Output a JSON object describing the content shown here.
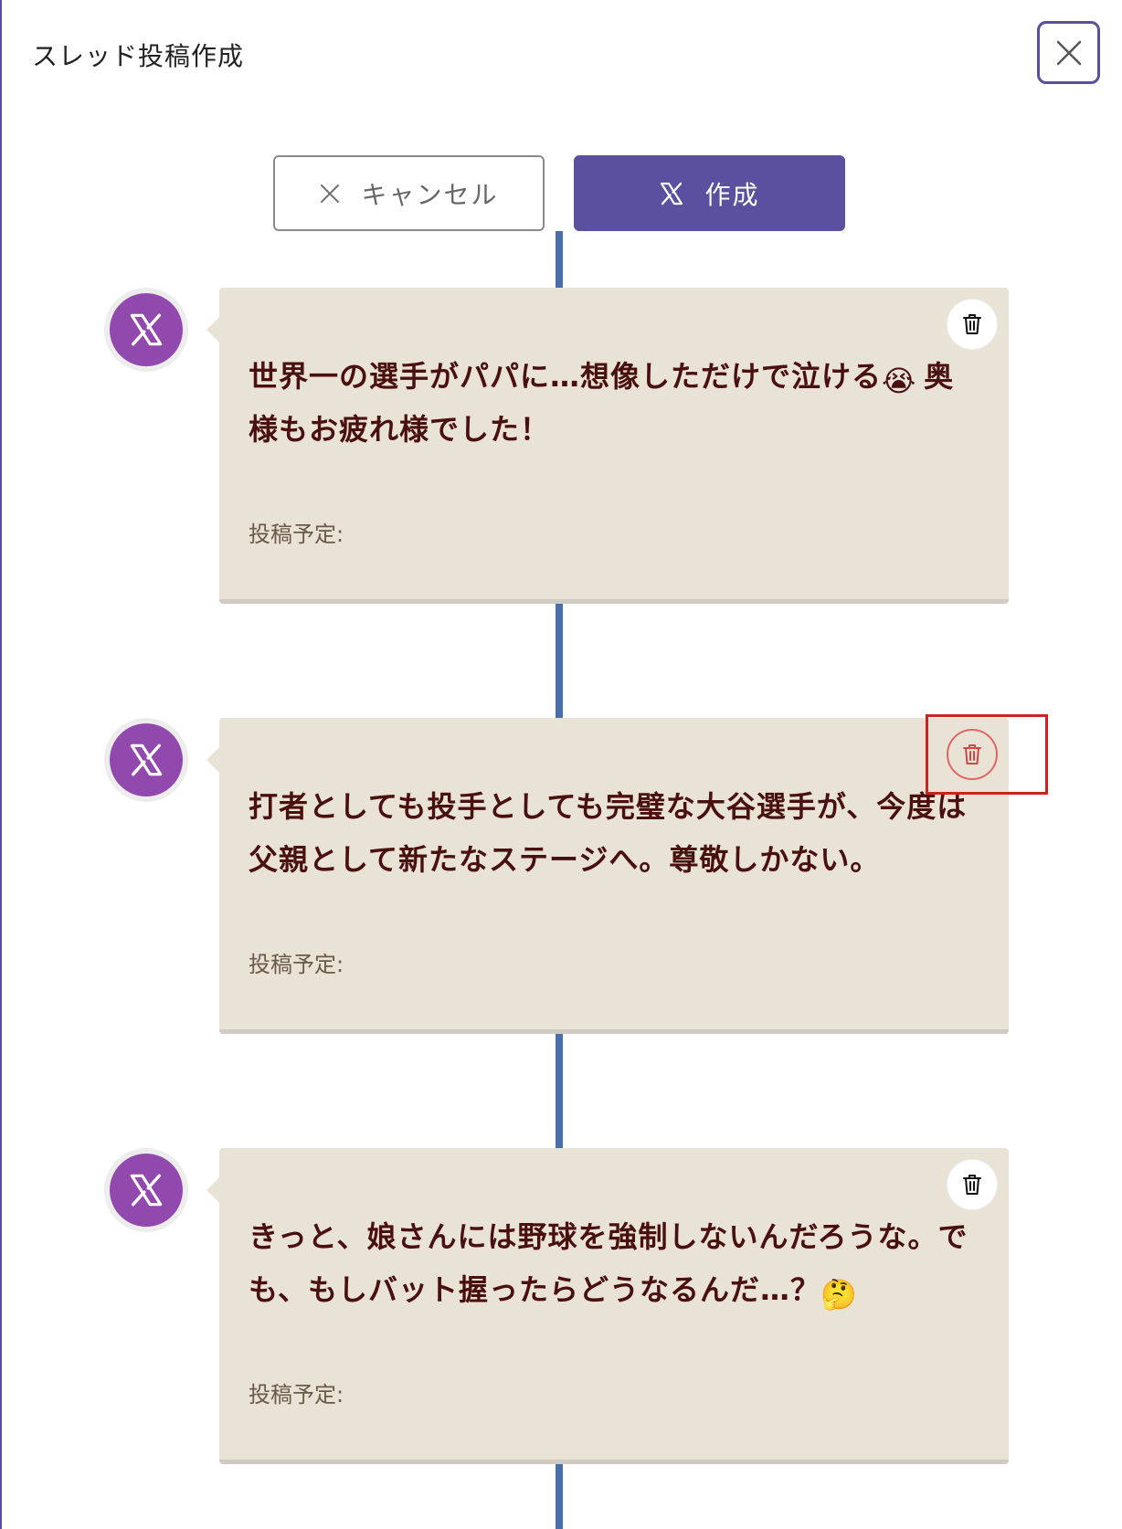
{
  "header": {
    "title": "スレッド投稿作成",
    "close_icon": "close-icon"
  },
  "actions": {
    "cancel_label": "キャンセル",
    "create_label": "作成"
  },
  "posts": [
    {
      "text": "世界一の選手がパパに…想像しただけで泣ける",
      "emoji": "😭",
      "text_after": " 奥様もお疲れ様でした！",
      "schedule_label": "投稿予定:"
    },
    {
      "text": "打者としても投手としても完璧な大谷選手が、今度は父親として新たなステージへ。尊敬しかない。",
      "schedule_label": "投稿予定:"
    },
    {
      "text": "きっと、娘さんには野球を強制しないんだろうな。でも、もしバット握ったらどうなるんだ…？",
      "emoji": "🤔",
      "schedule_label": "投稿予定:"
    }
  ],
  "colors": {
    "accent": "#5a509f",
    "avatar": "#9249ad",
    "timeline": "#4a6fa6",
    "card_bg": "#e9e3d6",
    "text": "#4a1010",
    "danger": "#e26565",
    "highlight": "#cc2222"
  }
}
